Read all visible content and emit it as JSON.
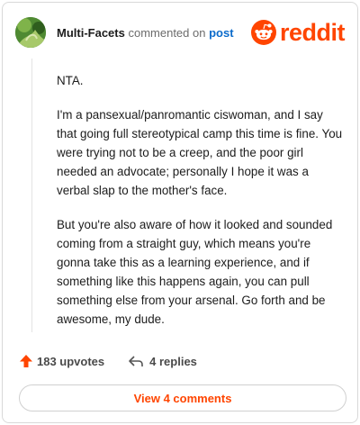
{
  "comment": {
    "author": "Multi-Facets",
    "action_text": "commented on",
    "post_link": "post",
    "paragraphs": [
      "NTA.",
      "I'm a pansexual/panromantic ciswoman, and I say that going full stereotypical camp this time is fine. You were trying not to be a creep, and the poor girl needed an advocate; personally I hope it was a verbal slap to the mother's face.",
      "But you're also aware of how it looked and sounded coming from a straight guy, which means you're gonna take this as a learning experience, and if something like this happens again, you can pull something else from your arsenal. Go forth and be awesome, my dude."
    ],
    "upvotes_label": "183 upvotes",
    "replies_label": "4 replies"
  },
  "logo": {
    "text": "reddit",
    "icon": "reddit-alien-icon",
    "color": "#ff4500"
  },
  "view_comments_label": "View 4 comments",
  "colors": {
    "accent": "#ff4500",
    "link": "#0b6bcb",
    "text": "#1c1c1c"
  }
}
